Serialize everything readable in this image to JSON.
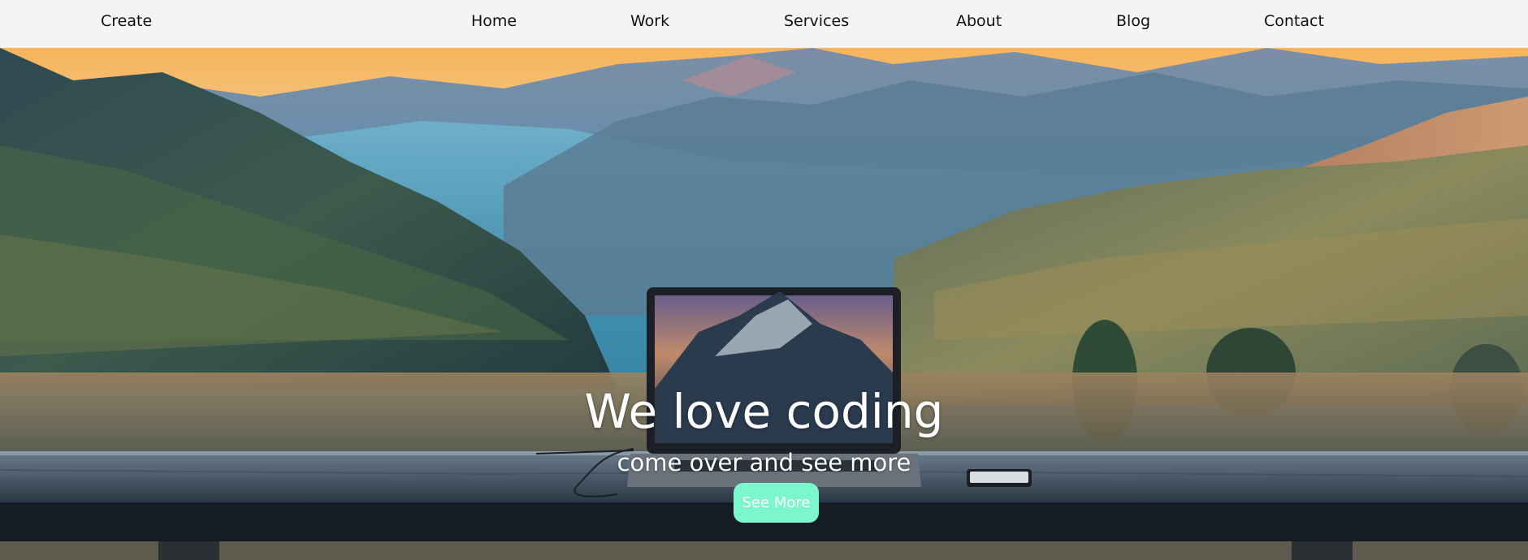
{
  "nav": {
    "brand": "Create",
    "links": [
      "Home",
      "Work",
      "Services",
      "About",
      "Blog",
      "Contact"
    ]
  },
  "hero": {
    "title": "We love coding",
    "subtitle": "come over and see more",
    "cta_label": "See More"
  },
  "colors": {
    "navbar_bg": "#f4f4f4",
    "cta_bg": "#7bf7cb",
    "hero_text": "#ffffff"
  }
}
